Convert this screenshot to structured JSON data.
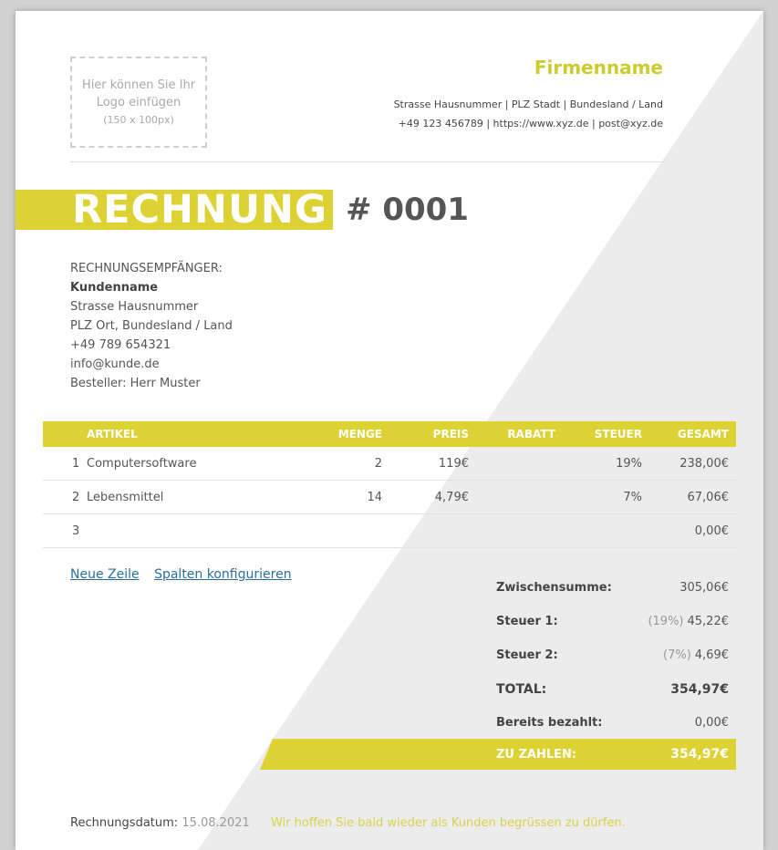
{
  "logo_placeholder": {
    "line1": "Hier können Sie Ihr",
    "line2": "Logo einfügen",
    "size_hint": "(150 x 100px)"
  },
  "company": {
    "name": "Firmenname",
    "address_line": "Strasse Hausnummer | PLZ Stadt | Bundesland / Land",
    "contact_line": "+49 123 456789 | https://www.xyz.de | post@xyz.de"
  },
  "invoice": {
    "title": "RECHNUNG",
    "number": "# 0001"
  },
  "recipient": {
    "label": "RECHNUNGSEMPFÄNGER:",
    "name": "Kundenname",
    "street": "Strasse Hausnummer",
    "city": "PLZ Ort, Bundesland / Land",
    "phone": "+49 789 654321",
    "email": "info@kunde.de",
    "orderer": "Besteller: Herr Muster"
  },
  "table": {
    "headers": {
      "article": "ARTIKEL",
      "quantity": "MENGE",
      "price": "PREIS",
      "discount": "RABATT",
      "tax": "STEUER",
      "total": "GESAMT"
    },
    "rows": [
      {
        "idx": "1",
        "article": "Computersoftware",
        "quantity": "2",
        "price": "119€",
        "discount": "",
        "tax": "19%",
        "total": "238,00€"
      },
      {
        "idx": "2",
        "article": "Lebensmittel",
        "quantity": "14",
        "price": "4,79€",
        "discount": "",
        "tax": "7%",
        "total": "67,06€"
      },
      {
        "idx": "3",
        "article": "",
        "quantity": "",
        "price": "",
        "discount": "",
        "tax": "",
        "total": "0,00€"
      }
    ]
  },
  "links": {
    "new_row": "Neue Zeile",
    "configure_columns": "Spalten konfigurieren"
  },
  "totals": {
    "subtotal_label": "Zwischensumme:",
    "subtotal_value": "305,06€",
    "tax1_label": "Steuer 1:",
    "tax1_rate": "(19%)",
    "tax1_value": "45,22€",
    "tax2_label": "Steuer 2:",
    "tax2_rate": "(7%)",
    "tax2_value": "4,69€",
    "total_label": "TOTAL:",
    "total_value": "354,97€",
    "paid_label": "Bereits bezahlt:",
    "paid_value": "0,00€",
    "due_label": "ZU ZAHLEN:",
    "due_value": "354,97€"
  },
  "footer": {
    "date_label": "Rechnungsdatum:",
    "date_value": "15.08.2021",
    "message": "Wir hoffen Sie bald wieder als Kunden begrüssen zu dürfen."
  },
  "colors": {
    "accent": "#dcd234",
    "company_name": "#cccc2e",
    "background_triangle": "#ececec",
    "link": "#2a6f9b"
  }
}
